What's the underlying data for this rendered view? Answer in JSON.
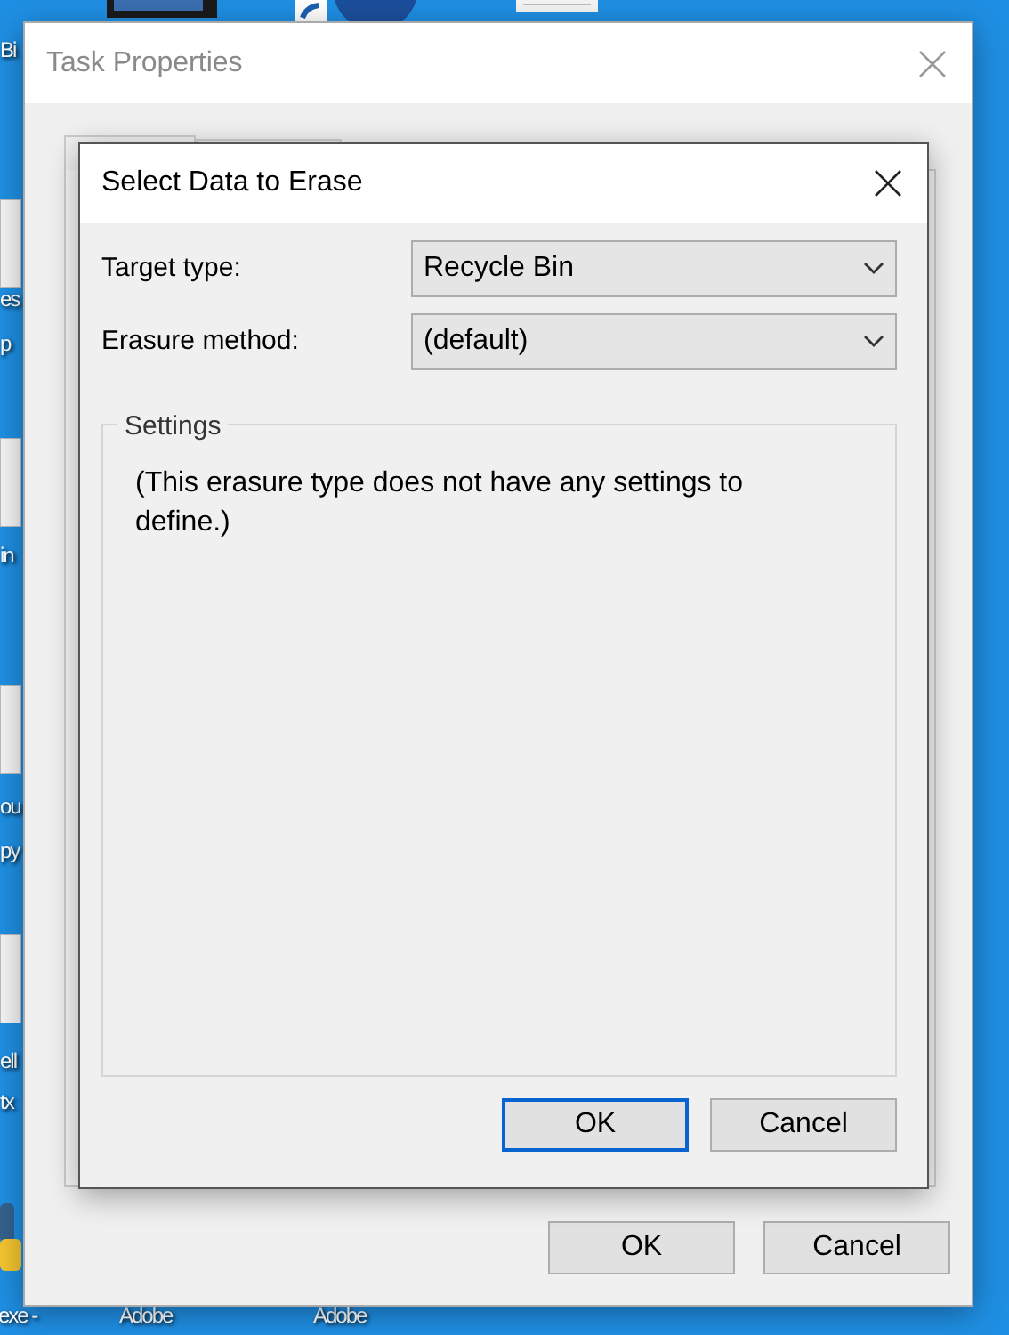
{
  "desktop": {
    "icon_labels": [
      "Bi",
      "es",
      "p",
      "in",
      "ou",
      "py",
      "ell",
      "tx",
      "exe -",
      "Adobe",
      "Adobe"
    ]
  },
  "task_window": {
    "title": "Task Properties",
    "buttons": [
      {
        "label": "OK"
      },
      {
        "label": "Cancel"
      }
    ]
  },
  "dialog": {
    "title": "Select Data to Erase",
    "fields": [
      {
        "label": "Target type:",
        "value": "Recycle Bin"
      },
      {
        "label": "Erasure method:",
        "value": "(default)"
      }
    ],
    "settings": {
      "title": "Settings",
      "text": "(This erasure type does not have any settings to define.)"
    },
    "buttons": [
      {
        "label": "OK",
        "default": true
      },
      {
        "label": "Cancel",
        "default": false
      }
    ]
  }
}
